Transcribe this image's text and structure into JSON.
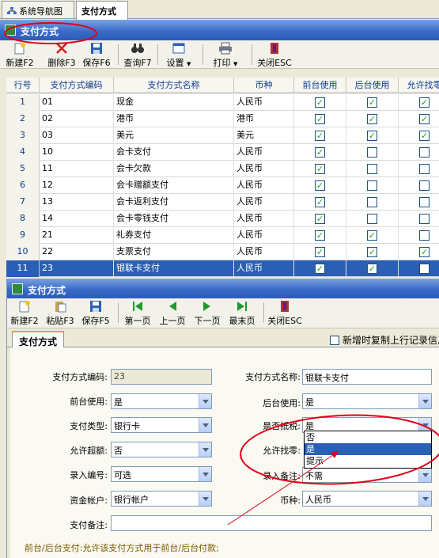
{
  "top_tabs": [
    "系统导航图",
    "支付方式"
  ],
  "window_title": "支付方式",
  "toolbar": {
    "new": "新建F2",
    "delete": "删除F3",
    "save": "保存F6",
    "query": "查询F7",
    "settings": "设置",
    "print": "打印",
    "close": "关闭ESC"
  },
  "grid": {
    "headers": [
      "行号",
      "支付方式编码",
      "支付方式名称",
      "币种",
      "前台使用",
      "后台使用",
      "允许找零"
    ],
    "rows": [
      {
        "no": "1",
        "code": "01",
        "name": "现金",
        "currency": "人民币",
        "front": true,
        "back": true,
        "change": true
      },
      {
        "no": "2",
        "code": "02",
        "name": "港币",
        "currency": "港币",
        "front": true,
        "back": true,
        "change": true
      },
      {
        "no": "3",
        "code": "03",
        "name": "美元",
        "currency": "美元",
        "front": true,
        "back": true,
        "change": true
      },
      {
        "no": "4",
        "code": "10",
        "name": "会卡支付",
        "currency": "人民币",
        "front": true,
        "back": false,
        "change": false
      },
      {
        "no": "5",
        "code": "11",
        "name": "会卡欠款",
        "currency": "人民币",
        "front": true,
        "back": false,
        "change": false
      },
      {
        "no": "6",
        "code": "12",
        "name": "会卡赠额支付",
        "currency": "人民币",
        "front": true,
        "back": false,
        "change": false
      },
      {
        "no": "7",
        "code": "13",
        "name": "会卡返利支付",
        "currency": "人民币",
        "front": true,
        "back": false,
        "change": false
      },
      {
        "no": "8",
        "code": "14",
        "name": "会卡零钱支付",
        "currency": "人民币",
        "front": true,
        "back": false,
        "change": false
      },
      {
        "no": "9",
        "code": "21",
        "name": "礼券支付",
        "currency": "人民币",
        "front": true,
        "back": true,
        "change": false
      },
      {
        "no": "10",
        "code": "22",
        "name": "支票支付",
        "currency": "人民币",
        "front": true,
        "back": true,
        "change": true
      },
      {
        "no": "11",
        "code": "23",
        "name": "银联卡支付",
        "currency": "人民币",
        "front": true,
        "back": true,
        "change": false
      }
    ]
  },
  "detail": {
    "title": "支付方式",
    "toolbar": {
      "new": "新建F2",
      "paste": "粘贴F3",
      "save": "保存F5",
      "first": "第一页",
      "prev": "上一页",
      "next": "下一页",
      "last": "最末页",
      "close": "关闭ESC"
    },
    "tab": "支付方式",
    "copy_checkbox_label": "新增时复制上行记录信息",
    "fields": {
      "code_label": "支付方式编码:",
      "code_value": "23",
      "name_label": "支付方式名称:",
      "name_value": "银联卡支付",
      "front_label": "前台使用:",
      "front_value": "是",
      "back_label": "后台使用:",
      "back_value": "是",
      "type_label": "支付类型:",
      "type_value": "银行卡",
      "tax_label": "是否抵税:",
      "tax_value": "是",
      "overpay_label": "允许超额:",
      "overpay_value": "否",
      "change_label": "允许找零:",
      "entry_label": "录入编号:",
      "entry_value": "可选",
      "remark_entry_label": "录入备注:",
      "remark_entry_value": "不需",
      "account_label": "资金帐户:",
      "account_value": "银行帐户",
      "currency_label": "币种:",
      "currency_value": "人民币",
      "remark_label": "支付备注:",
      "remark_value": ""
    },
    "dropdown_options": [
      "否",
      "是",
      "提示"
    ],
    "dropdown_selected": "是",
    "note": "前台/后台支付:允许该支付方式用于前台/后台付款;"
  },
  "colors": {
    "annotation": "#e0001b",
    "selection": "#2b5fb4",
    "check": "#21a121"
  }
}
